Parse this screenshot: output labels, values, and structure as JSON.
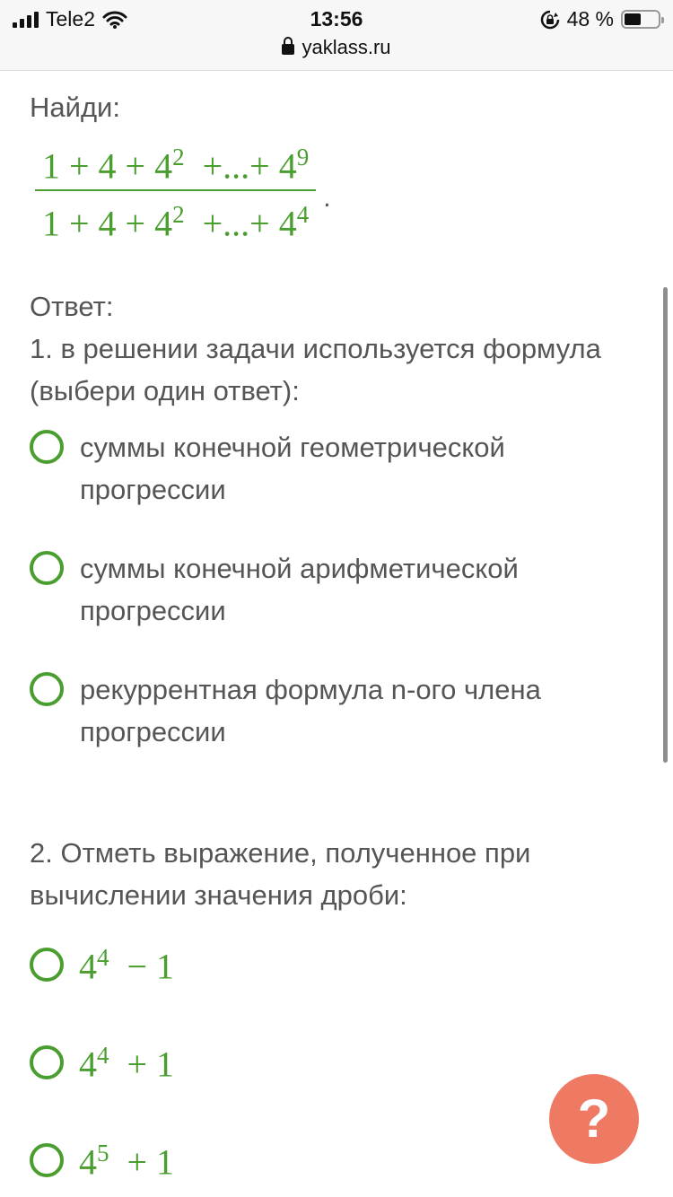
{
  "status_bar": {
    "carrier": "Tele2",
    "time": "13:56",
    "battery": "48 %",
    "battery_level": 0.48
  },
  "browser": {
    "url": "yaklass.ru"
  },
  "task": {
    "prompt": "Найди:",
    "fraction": {
      "numerator": [
        "1 + 4 + 4",
        "2",
        "  +...+ 4",
        "9"
      ],
      "denominator": [
        "1 + 4 + 4",
        "2",
        "  +...+ 4",
        "4"
      ]
    },
    "period": "."
  },
  "answer": {
    "label": "Ответ:",
    "question1": {
      "text": "1. в решении задачи используется формула (выбери один ответ):",
      "options": [
        "суммы конечной геометрической прогрессии",
        "суммы конечной арифметической прогрессии",
        "рекуррентная формула n-ого члена прогрессии"
      ]
    },
    "question2": {
      "text": "2. Отметь выражение, полученное при вычислении значения дроби:",
      "options": [
        {
          "base": "4",
          "exp": "4",
          "rest": "  − 1"
        },
        {
          "base": "4",
          "exp": "4",
          "rest": "  + 1"
        },
        {
          "base": "4",
          "exp": "5",
          "rest": "  + 1"
        }
      ]
    }
  },
  "help": {
    "label": "?"
  },
  "colors": {
    "accent_green": "#4a9e2f",
    "help_button": "#ef7a63",
    "text": "#555555"
  },
  "icons": [
    "wifi-icon",
    "signal-icon",
    "lock-icon",
    "rotation-lock-icon",
    "battery-icon"
  ]
}
